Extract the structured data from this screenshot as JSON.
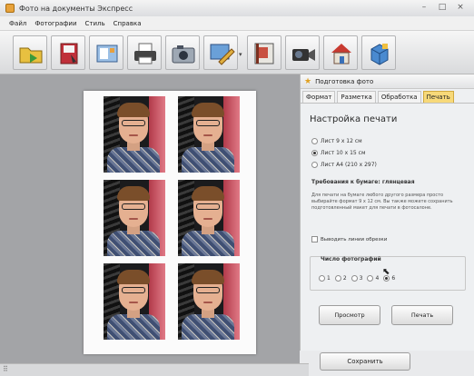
{
  "window": {
    "title": "Фото на документы Экспресс",
    "controls": [
      "–",
      "□",
      "×"
    ]
  },
  "menu": [
    "Файл",
    "Фотографии",
    "Стиль",
    "Справка"
  ],
  "toolbar": {
    "buttons": [
      "open-folder-icon",
      "save-icon",
      "template-icon",
      "printer-icon",
      "camera-icon",
      "edit-icon",
      "book-icon",
      "video-camera-icon",
      "home-icon",
      "box-icon"
    ]
  },
  "panel": {
    "title": "Подготовка фото",
    "tabs": [
      "Формат",
      "Разметка",
      "Обработка",
      "Печать"
    ],
    "active_tab": "Печать",
    "section_title": "Настройка печати",
    "paper_options": [
      {
        "label": "Лист 9 x 12 см",
        "selected": false
      },
      {
        "label": "Лист 10 x 15 см",
        "selected": true
      },
      {
        "label": "Лист А4 (210 x 297)",
        "selected": false
      }
    ],
    "requirement": "Требования к бумаге: глянцевая",
    "hint": "Для печати на бумаге любого другого размера просто выбирайте формат 9 x 12 см. Вы также можете сохранить подготовленный макет для печати в фотосалоне.",
    "cut_lines_label": "Выводить линии обрезки",
    "count_title": "Число фотографий",
    "count_options": [
      "1",
      "2",
      "3",
      "4",
      "6"
    ],
    "count_selected": "6",
    "preview_button": "Просмотр",
    "print_button": "Печать"
  },
  "save_button": "Сохранить"
}
